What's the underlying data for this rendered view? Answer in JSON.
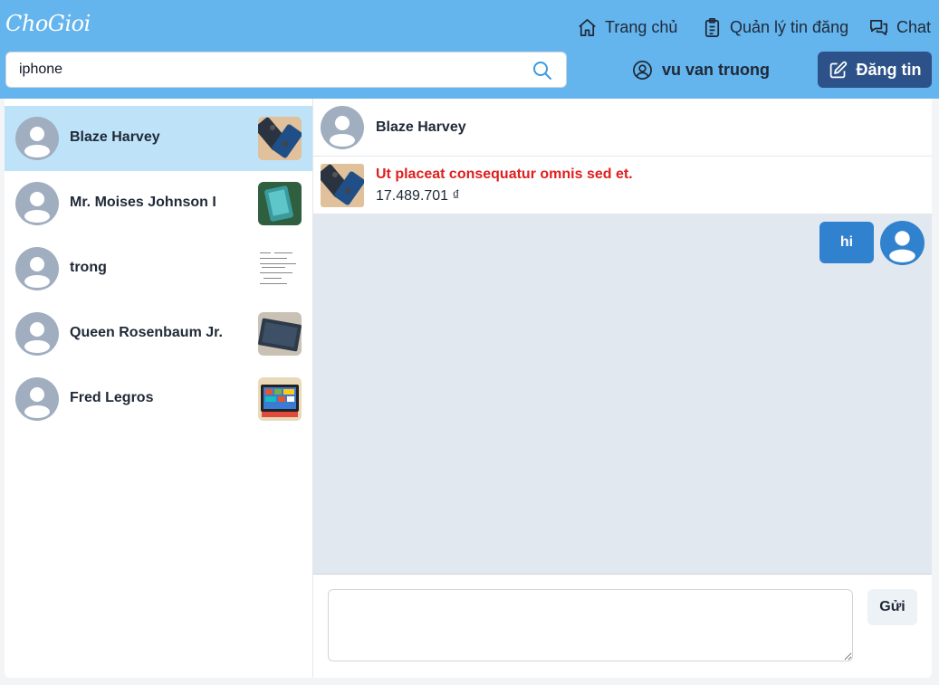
{
  "header": {
    "logo": "ChoGioi",
    "nav": {
      "home_label": "Trang chủ",
      "manage_label": "Quản lý tin đăng",
      "chat_label": "Chat"
    },
    "search": {
      "value": "iphone",
      "placeholder": ""
    },
    "user_name": "vu van truong",
    "post_button_label": "Đăng tin"
  },
  "conversations": [
    {
      "name": "Blaze Harvey",
      "active": true
    },
    {
      "name": "Mr. Moises Johnson I",
      "active": false
    },
    {
      "name": "trong",
      "active": false
    },
    {
      "name": "Queen Rosenbaum Jr.",
      "active": false
    },
    {
      "name": "Fred Legros",
      "active": false
    }
  ],
  "chat": {
    "partner_name": "Blaze Harvey",
    "product": {
      "title": "Ut placeat consequatur omnis sed et.",
      "price": "17.489.701 ₫"
    },
    "messages": [
      {
        "text": "hi",
        "from_me": true
      }
    ],
    "input": {
      "value": "",
      "placeholder": ""
    },
    "send_label": "Gửi"
  },
  "colors": {
    "header_bg": "#64b4ed",
    "post_button_bg": "#2c5289",
    "active_conversation_bg": "#bee3f8",
    "bubble_bg": "#3182ce",
    "product_title": "#e01e1e",
    "messages_bg": "#e2e8f0"
  },
  "icons": {
    "home": "home-icon",
    "manage": "clipboard-icon",
    "chat": "chat-bubbles-icon",
    "search": "search-icon",
    "user": "user-circle-icon",
    "post": "edit-icon",
    "avatar": "default-avatar-icon"
  }
}
